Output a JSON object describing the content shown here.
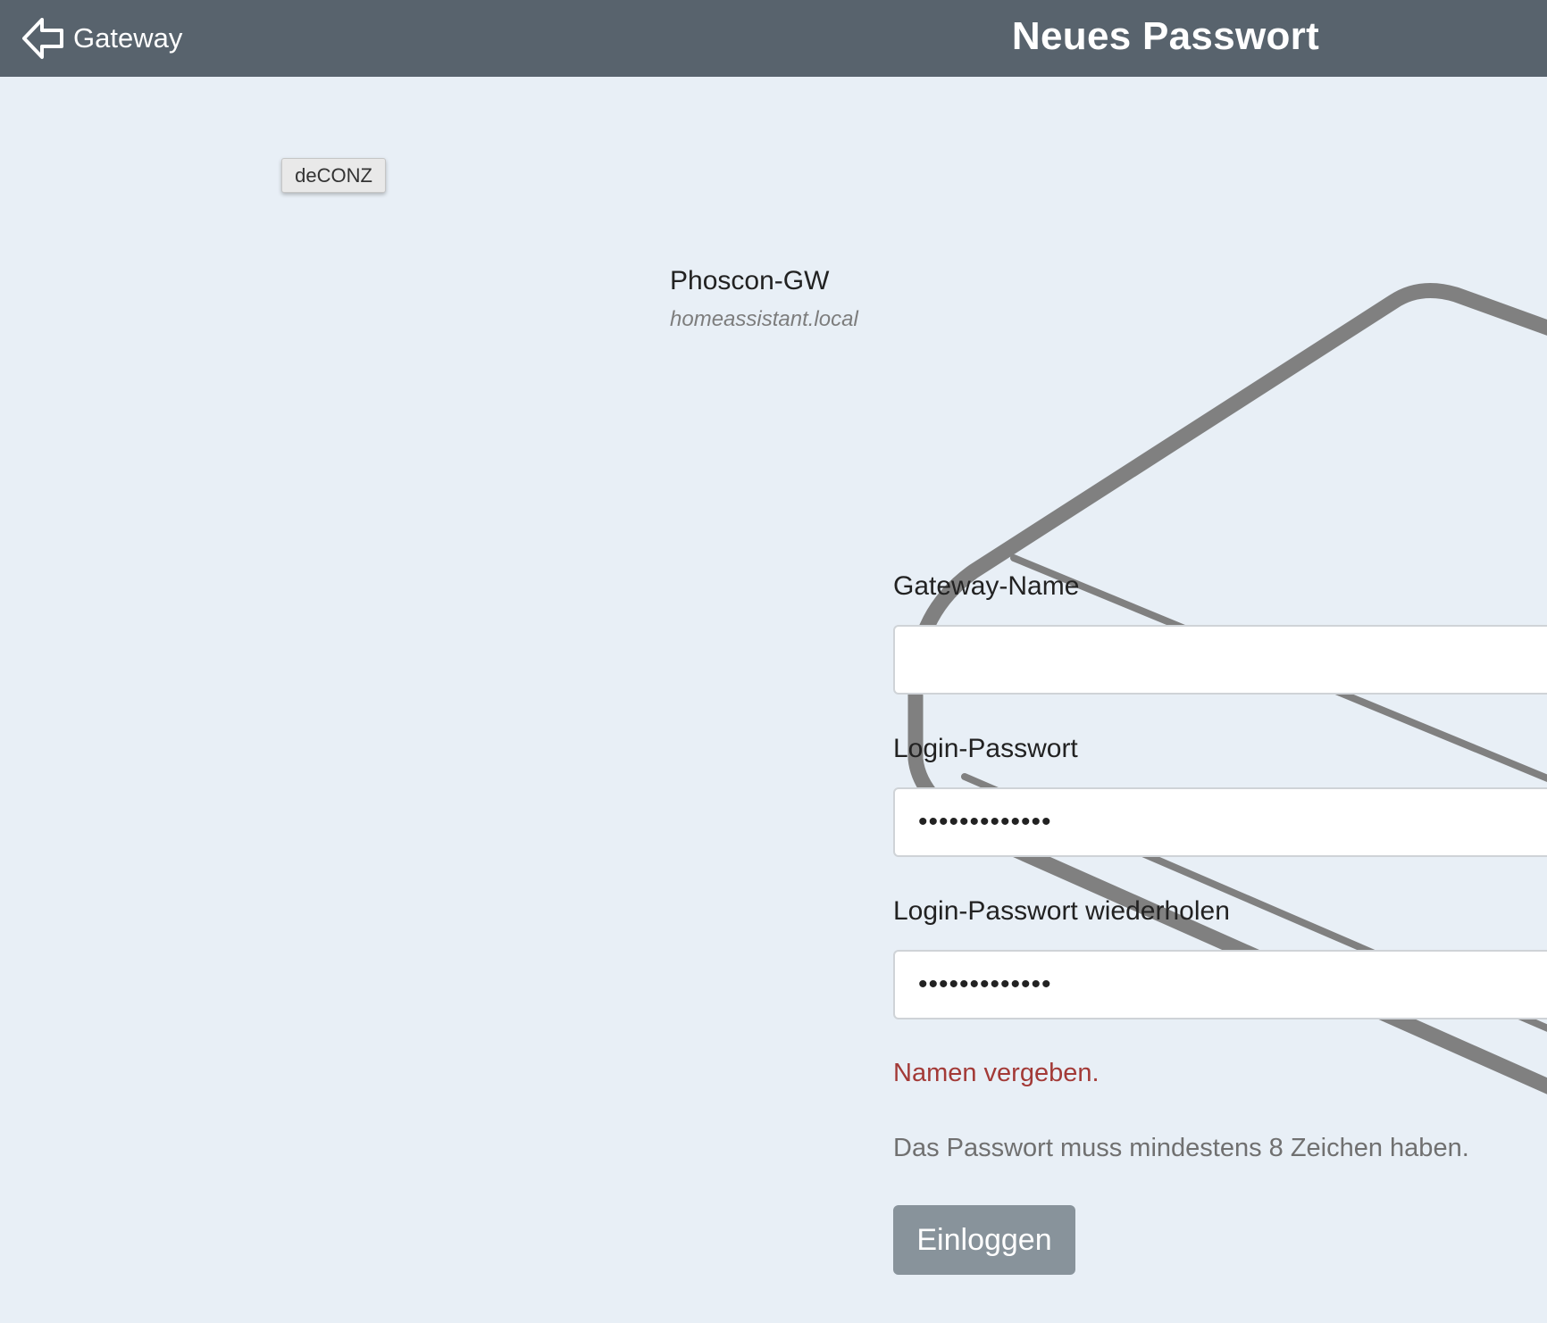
{
  "header": {
    "back_label": "Gateway",
    "back_icon": "arrow-left-icon",
    "title": "Neues Passwort",
    "background": "#58636d"
  },
  "badge": {
    "label": "deCONZ"
  },
  "gateway": {
    "name": "Phoscon-GW",
    "host": "homeassistant.local"
  },
  "form": {
    "name_label": "Gateway-Name",
    "name_value": "",
    "password_label": "Login-Passwort",
    "password_value": "•••••••••••••",
    "password_repeat_label": "Login-Passwort wiederholen",
    "password_repeat_value": "•••••••••••••",
    "error_message": "Namen vergeben.",
    "hint": "Das Passwort muss mindestens 8 Zeichen haben.",
    "submit_label": "Einloggen"
  },
  "colors": {
    "background": "#e8eff6",
    "error": "#a33a37",
    "button": "#88939b",
    "illustration": "#808080"
  }
}
